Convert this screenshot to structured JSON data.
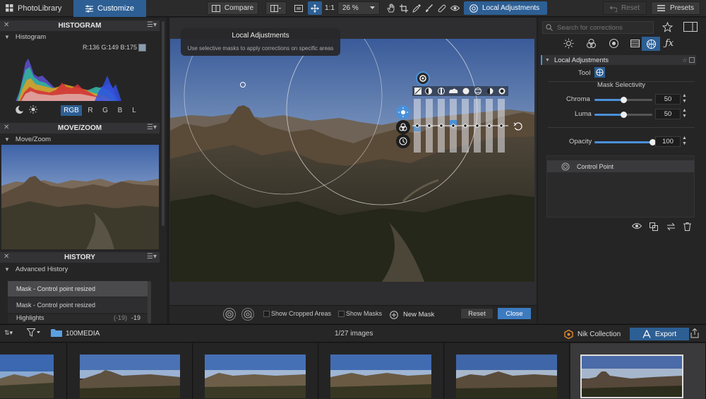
{
  "topbar": {
    "photolibrary_label": "PhotoLibrary",
    "customize_label": "Customize",
    "compare_label": "Compare",
    "zoom_ratio_label": "1:1",
    "zoom_value": "26 %",
    "local_adjustments_label": "Local Adjustments",
    "reset_label": "Reset",
    "presets_label": "Presets"
  },
  "left": {
    "histogram_title": "HISTOGRAM",
    "histogram_sub": "Histogram",
    "histogram_readout": "R:136 G:149 B:175",
    "histogram_swatch": "#889cb3",
    "channel_buttons": [
      "RGB",
      "R",
      "G",
      "B",
      "L"
    ],
    "movezoom_title": "MOVE/ZOOM",
    "movezoom_sub": "Move/Zoom",
    "history_title": "HISTORY",
    "history_sub": "Advanced History",
    "history_items": [
      {
        "label": "Mask - Control point resized"
      },
      {
        "label": "Mask - Control point resized"
      },
      {
        "label": "Highlights",
        "value": "(-19)",
        "value2": "-19"
      }
    ]
  },
  "tooltip": {
    "title": "Local Adjustments",
    "body": "Use selective masks to apply corrections on specific areas"
  },
  "canvas_bottom": {
    "show_cropped_label": "Show Cropped Areas",
    "show_masks_label": "Show Masks",
    "new_mask_label": "New Mask",
    "reset_label": "Reset",
    "close_label": "Close"
  },
  "right": {
    "search_placeholder": "Search for corrections",
    "panel_title": "Local Adjustments",
    "tool_label": "Tool",
    "mask_selectivity_label": "Mask Selectivity",
    "chroma_label": "Chroma",
    "chroma_value": "50",
    "chroma_fraction": 0.5,
    "luma_label": "Luma",
    "luma_value": "50",
    "luma_fraction": 0.5,
    "opacity_label": "Opacity",
    "opacity_value": "100",
    "opacity_fraction": 1.0,
    "control_point_label": "Control Point"
  },
  "filmstrip": {
    "folder_label": "100MEDIA",
    "count_label": "1/27 images",
    "nik_label": "Nik Collection",
    "export_label": "Export"
  },
  "colors": {
    "accent": "#3d7bc0",
    "selected_tab": "#2d5f94"
  }
}
